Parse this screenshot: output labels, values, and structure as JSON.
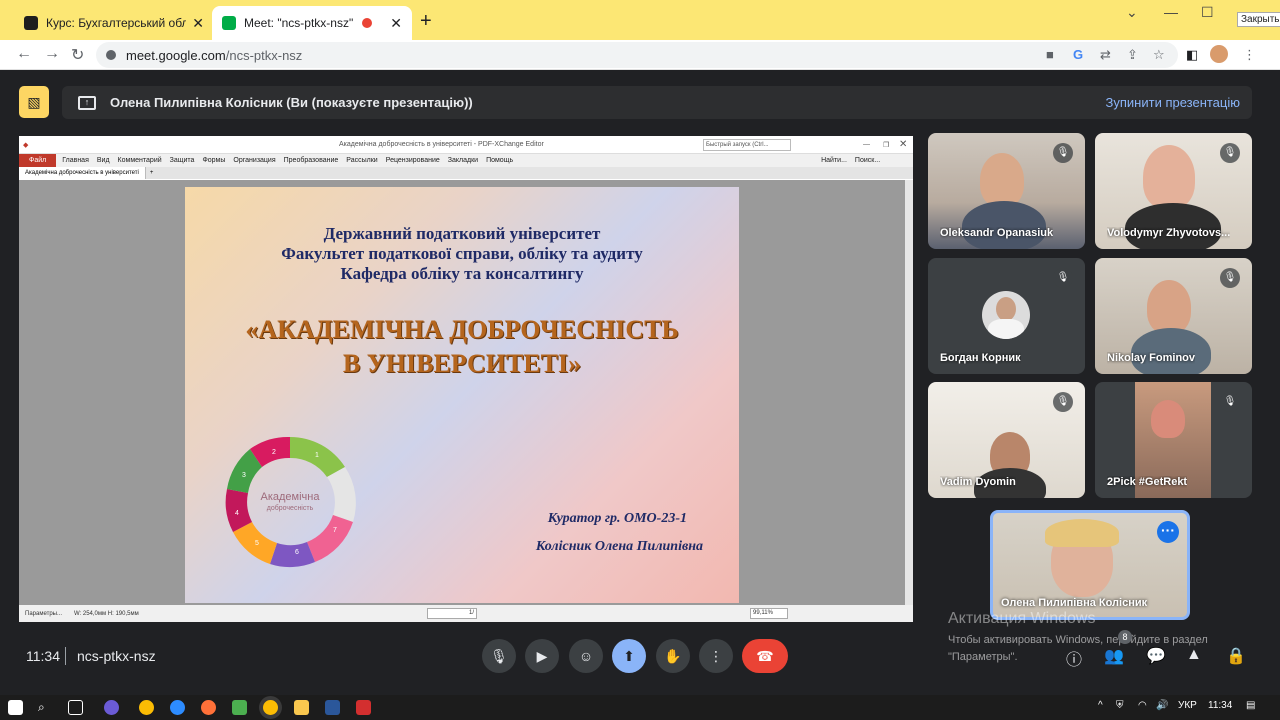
{
  "browser": {
    "tabs": [
      {
        "title": "Курс: Бухгалтерський облік в у",
        "favicon_color": "#1e1e1e"
      },
      {
        "title": "Meet: \"ncs-ptkx-nsz\"",
        "favicon_color": "#00ac47"
      }
    ],
    "close_tooltip": "Закрыть",
    "url_domain": "meet.google.com",
    "url_path": "/ncs-ptkx-nsz"
  },
  "presenting": {
    "text": "Олена Пилипівна Колісник (Ви (показуєте презентацію))",
    "stop_label": "Зупинити презентацію"
  },
  "pdf_editor": {
    "window_title": "Академічна доброчесність в університеті - PDF-XChange Editor",
    "search_placeholder": "Быстрый запуск (Ctrl...",
    "menu_file": "Файл",
    "menu": [
      "Главная",
      "Вид",
      "Комментарий",
      "Защита",
      "Формы",
      "Организация",
      "Преобразование",
      "Рассылки",
      "Рецензирование",
      "Закладки",
      "Помощь"
    ],
    "find_label": "Найти...",
    "search_label": "Поиск...",
    "doc_tab": "Академічна доброчесність в університеті",
    "status_params": "Параметры...",
    "status_size": "W: 254,0мм H: 190,5мм",
    "page_indicator": "1/",
    "zoom": "99,11%"
  },
  "slide": {
    "line1": "Державний податковий університет",
    "line2": "Факультет податкової справи, обліку та аудиту",
    "line3": "Кафедра обліку та консалтингу",
    "title1": "«АКАДЕМІЧНА ДОБРОЧЕСНІСТЬ",
    "title2": "В УНІВЕРСИТЕТІ»",
    "curator": "Куратор гр. ОМО-23-1",
    "name": "Колісник Олена Пилипівна",
    "cycle_center1": "Академічна",
    "cycle_center2": "доброчесність",
    "cycle_numbers": [
      "1",
      "2",
      "3",
      "4",
      "5",
      "6",
      "7"
    ]
  },
  "participants": [
    {
      "name": "Oleksandr Opanasiuk"
    },
    {
      "name": "Volodymyr Zhyvotovs..."
    },
    {
      "name": "Богдан Корник"
    },
    {
      "name": "Nikolay Fominov"
    },
    {
      "name": "Vadim Dyomin"
    },
    {
      "name": "2Pick #GetRekt"
    }
  ],
  "self_tile": {
    "name": "Олена Пилипівна Колісник"
  },
  "watermark": {
    "title": "Активация Windows",
    "line": "Чтобы активировать Windows, перейдите в раздел \"Параметры\"."
  },
  "bottom_bar": {
    "time": "11:34",
    "meeting_code": "ncs-ptkx-nsz",
    "people_count": "8"
  },
  "taskbar": {
    "lang": "УКР",
    "time": "11:34"
  }
}
